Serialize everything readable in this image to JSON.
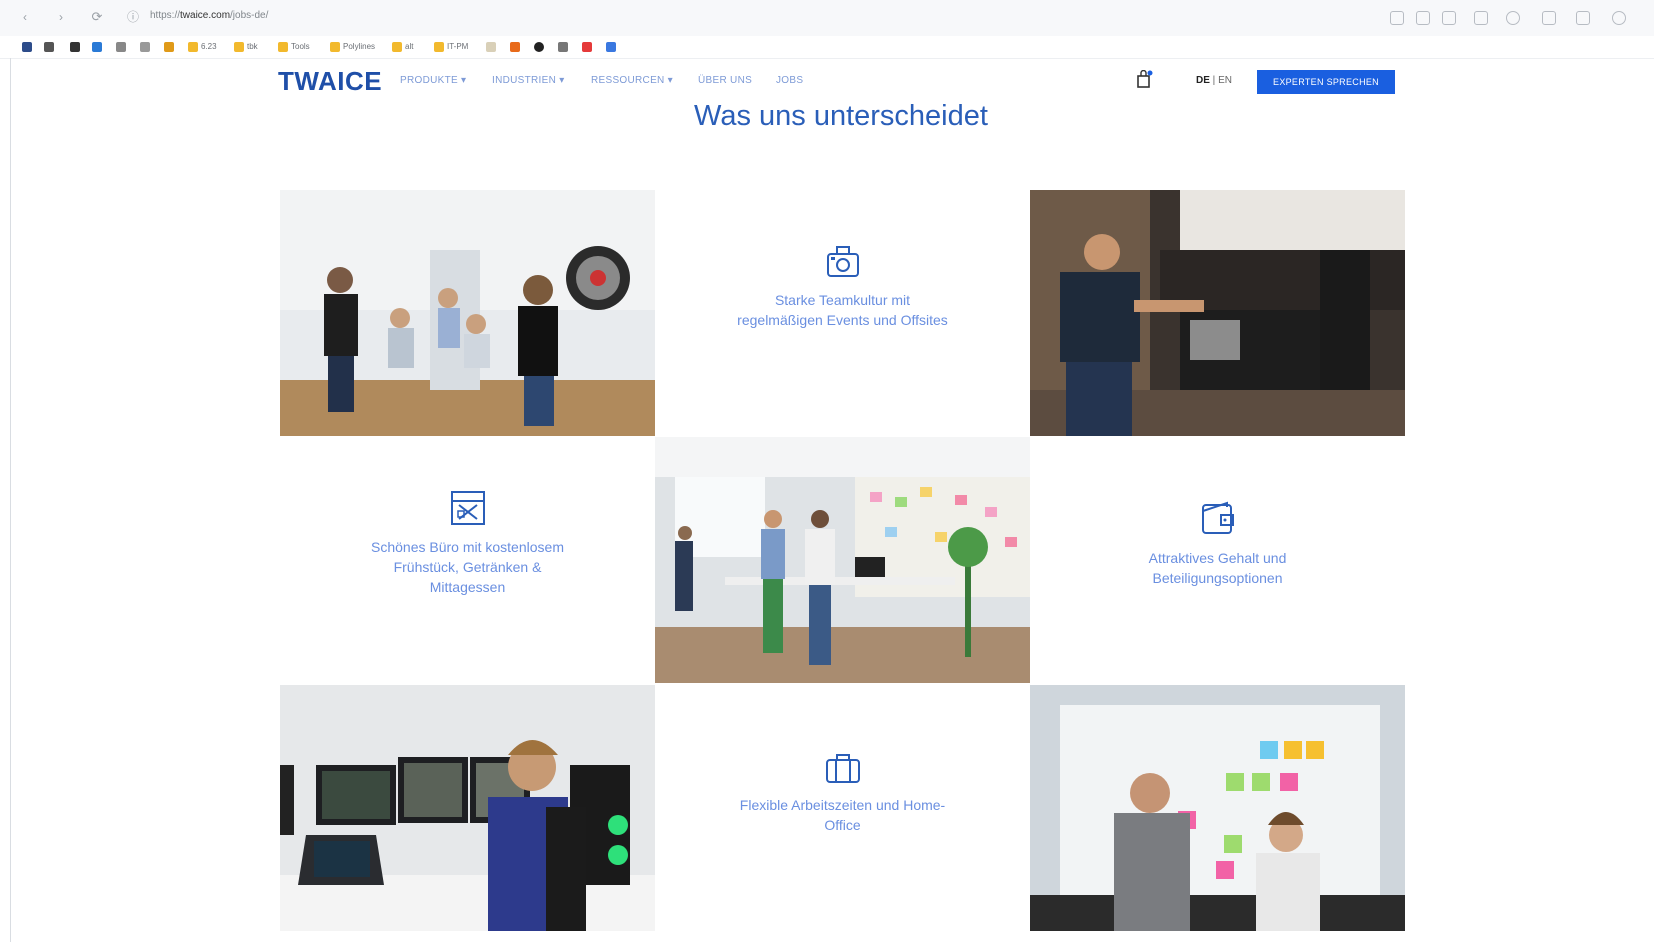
{
  "browser": {
    "url_prefix": "https://",
    "url_host": "twaice.com",
    "url_path": "/jobs-de/",
    "bookmarks": [
      "6.23",
      "tbk",
      "Tools",
      "Polylines",
      "alt",
      "IT-PM"
    ]
  },
  "header": {
    "logo_prefix": "TW",
    "logo_highlight": "AI",
    "logo_suffix": "CE",
    "menu": [
      "PRODUKTE ▾",
      "INDUSTRIEN ▾",
      "RESSOURCEN ▾",
      "ÜBER UNS",
      "JOBS"
    ],
    "lang_active": "DE",
    "lang_sep": " | ",
    "lang_other": "EN",
    "cta_label": "EXPERTEN SPRECHEN"
  },
  "section": {
    "title": "Was uns unterscheidet"
  },
  "benefits": [
    {
      "icon": "camera-icon",
      "label": "Starke Teamkultur mit regelmäßigen Events und Offsites"
    },
    {
      "icon": "office-icon",
      "label": "Schönes Büro mit kostenlosem Frühstück, Getränken & Mittagessen"
    },
    {
      "icon": "wallet-icon",
      "label": "Attraktives Gehalt und Beteiligungsoptionen"
    },
    {
      "icon": "suitcase-icon",
      "label": "Flexible Arbeitszeiten und Home-Office"
    }
  ],
  "colors": {
    "brand": "#1f4fa8",
    "accent": "#1a5fe0",
    "benefit_text": "#6a8fe0"
  }
}
